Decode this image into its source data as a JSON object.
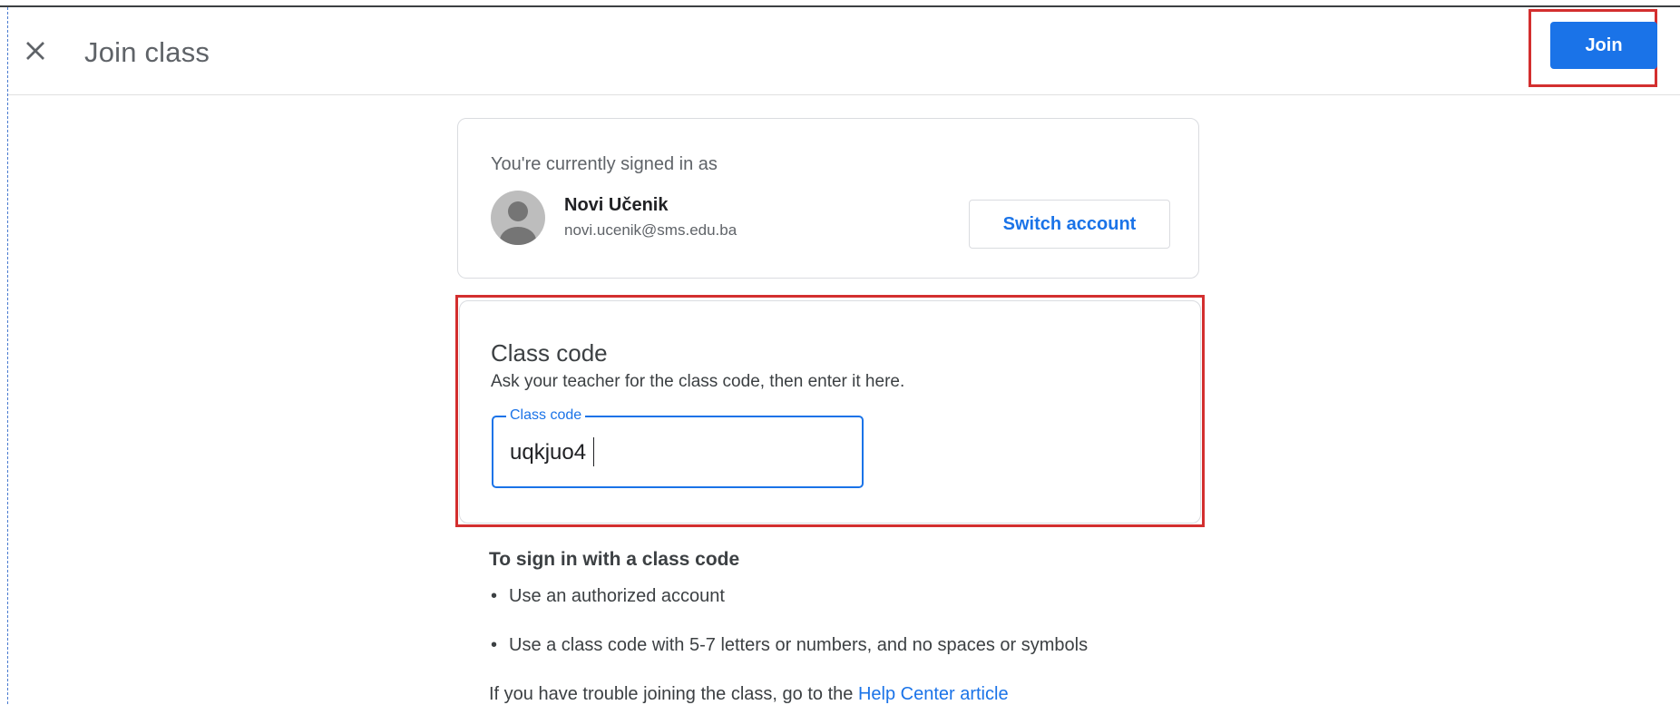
{
  "header": {
    "title": "Join class",
    "close_icon": "close-icon",
    "join_label": "Join"
  },
  "account": {
    "signed_in_label": "You're currently signed in as",
    "name": "Novi Učenik",
    "email": "novi.ucenik@sms.edu.ba",
    "avatar_icon": "account-avatar-icon",
    "switch_label": "Switch account"
  },
  "class_code": {
    "title": "Class code",
    "description": "Ask your teacher for the class code, then enter it here.",
    "field_label": "Class code",
    "value": "uqkjuo4"
  },
  "info": {
    "title": "To sign in with a class code",
    "items": [
      "Use an authorized account",
      "Use a class code with 5-7 letters or numbers, and no spaces or symbols"
    ],
    "trouble_prefix": "If you have trouble joining the class, go to the",
    "help_link": "Help Center article"
  },
  "colors": {
    "primary": "#1a73e8",
    "highlight": "#d32f2f",
    "border": "#dadce0"
  }
}
